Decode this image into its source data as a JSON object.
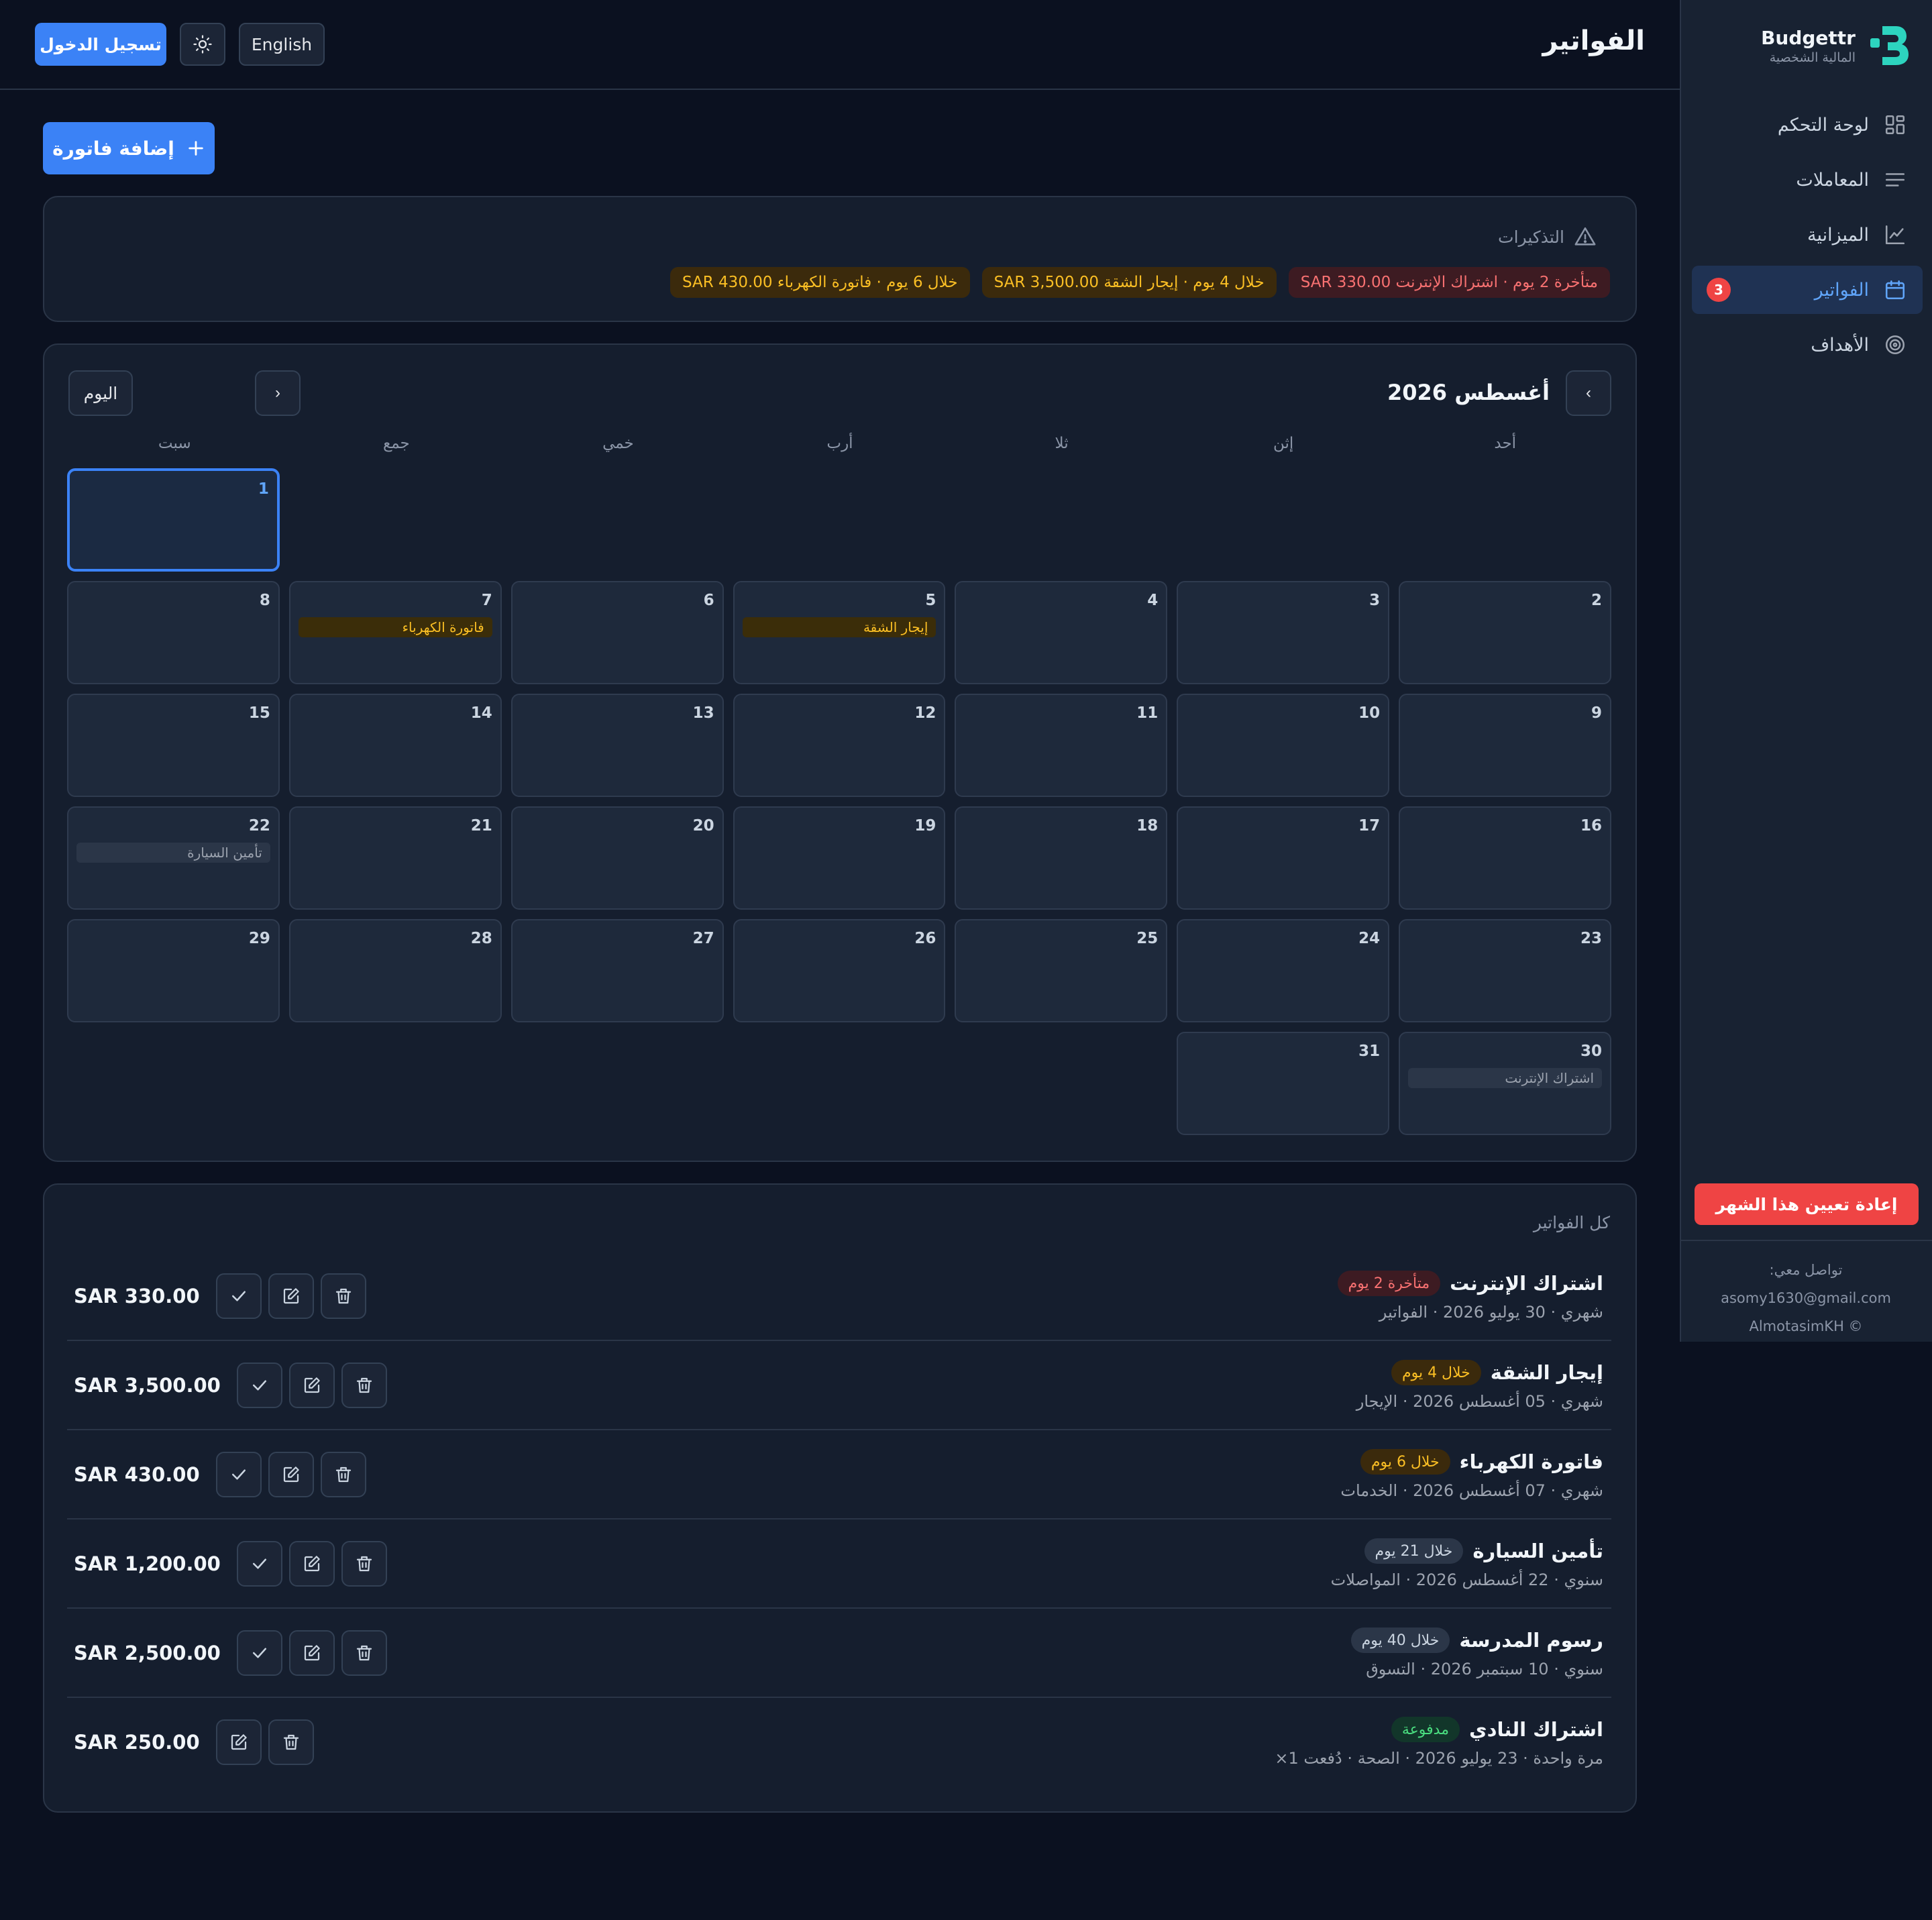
{
  "sidebar": {
    "brand_name": "Budgettr",
    "brand_sub": "المالية الشخصية",
    "items": [
      {
        "label": "لوحة التحكم",
        "icon": "dashboard-icon"
      },
      {
        "label": "المعاملات",
        "icon": "list-icon"
      },
      {
        "label": "الميزانية",
        "icon": "chart-icon"
      },
      {
        "label": "الفواتير",
        "icon": "calendar-icon",
        "badge": "3",
        "active": true
      },
      {
        "label": "الأهداف",
        "icon": "target-icon"
      }
    ],
    "reset_label": "إعادة تعيين هذا الشهر",
    "contact_label": "تواصل معي:",
    "email": "asomy1630@gmail.com",
    "copyright": "AlmotasimKH ©"
  },
  "header": {
    "title": "الفواتير",
    "login_label": "تسجيل الدخول",
    "theme_icon": "sun-icon",
    "lang_label": "English"
  },
  "main": {
    "add_bill_label": "إضافة فاتورة",
    "reminders": {
      "title": "التذكيرات",
      "chips": [
        {
          "text": "متأخرة 2 يوم · اشتراك الإنترنت SAR 330.00",
          "kind": "overdue"
        },
        {
          "text": "خلال 4 يوم · إيجار الشقة SAR 3,500.00",
          "kind": "soon"
        },
        {
          "text": "خلال 6 يوم · فاتورة الكهرباء SAR 430.00",
          "kind": "soon"
        }
      ]
    },
    "calendar": {
      "month_label": "أغسطس 2026",
      "today_label": "اليوم",
      "prev": "‹",
      "next": "›",
      "weekdays": [
        "أحد",
        "إثن",
        "ثلا",
        "أرب",
        "خمي",
        "جمع",
        "سبت"
      ],
      "events": {
        "5": {
          "label": "إيجار الشقة",
          "kind": "amber"
        },
        "7": {
          "label": "فاتورة الكهرباء",
          "kind": "amber"
        },
        "22": {
          "label": "تأمين السيارة",
          "kind": "gray"
        },
        "30": {
          "label": "اشتراك الإنترنت",
          "kind": "gray"
        }
      },
      "today_day": 1
    },
    "bills": {
      "title": "كل الفواتير",
      "items": [
        {
          "name": "اشتراك الإنترنت",
          "badge": "متأخرة 2 يوم",
          "status": "overdue",
          "meta": "شهري · 30 يوليو 2026 · الفواتير",
          "amount": "SAR 330.00",
          "can_mark_paid": true
        },
        {
          "name": "إيجار الشقة",
          "badge": "خلال 4 يوم",
          "status": "soon",
          "meta": "شهري · 05 أغسطس 2026 · الإيجار",
          "amount": "SAR 3,500.00",
          "can_mark_paid": true
        },
        {
          "name": "فاتورة الكهرباء",
          "badge": "خلال 6 يوم",
          "status": "soon",
          "meta": "شهري · 07 أغسطس 2026 · الخدمات",
          "amount": "SAR 430.00",
          "can_mark_paid": true
        },
        {
          "name": "تأمين السيارة",
          "badge": "خلال 21 يوم",
          "status": "later",
          "meta": "سنوي · 22 أغسطس 2026 · المواصلات",
          "amount": "SAR 1,200.00",
          "can_mark_paid": true
        },
        {
          "name": "رسوم المدرسة",
          "badge": "خلال 40 يوم",
          "status": "later",
          "meta": "سنوي · 10 سبتمبر 2026 · التسوق",
          "amount": "SAR 2,500.00",
          "can_mark_paid": true
        },
        {
          "name": "اشتراك النادي",
          "badge": "مدفوعة",
          "status": "paid",
          "meta": "مرة واحدة · 23 يوليو 2026 · الصحة · دُفعت 1×",
          "amount": "SAR 250.00",
          "can_mark_paid": false
        }
      ]
    }
  },
  "colors": {
    "accent": "#3b82f6",
    "danger": "#ef4444",
    "warning": "#fbbf24",
    "success": "#4ade80",
    "background": "#0b1120",
    "card": "#151e2e"
  }
}
